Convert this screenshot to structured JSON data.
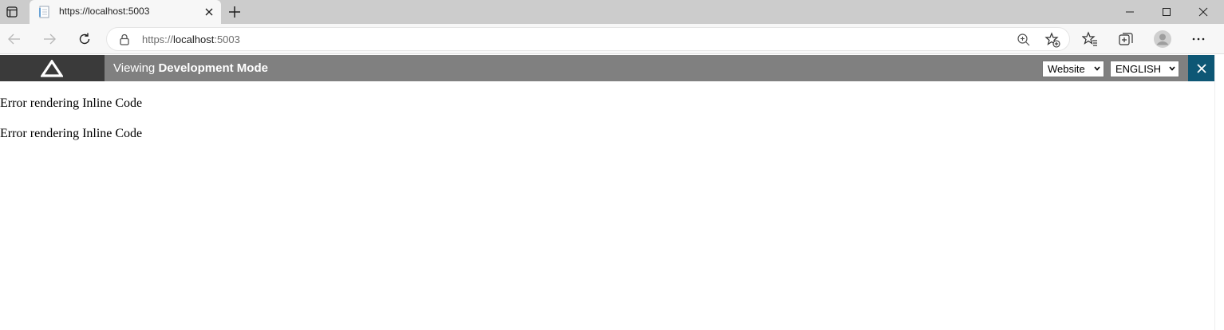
{
  "browser": {
    "tab": {
      "title": "https://localhost:5003",
      "favicon": "page-icon"
    },
    "address": {
      "protocol": "https://",
      "host": "localhost",
      "port": ":5003"
    },
    "icons": [
      "tab-actions-icon",
      "close-icon",
      "new-tab-icon",
      "minimize-icon",
      "maximize-icon",
      "window-close-icon",
      "back-icon",
      "forward-icon",
      "refresh-icon",
      "lock-icon",
      "zoom-icon",
      "add-favorite-icon",
      "favorites-icon",
      "collections-icon",
      "profile-icon",
      "more-icon"
    ]
  },
  "devbar": {
    "title_prefix": "Viewing ",
    "title_mode": "Development Mode",
    "site_select": "Website",
    "language_select": "ENGLISH",
    "colors": {
      "bar": "#808080",
      "logo_bg": "#3a3a3a",
      "close_bg": "#0e5775"
    }
  },
  "content": {
    "lines": [
      "Error rendering Inline Code",
      "Error rendering Inline Code"
    ]
  }
}
